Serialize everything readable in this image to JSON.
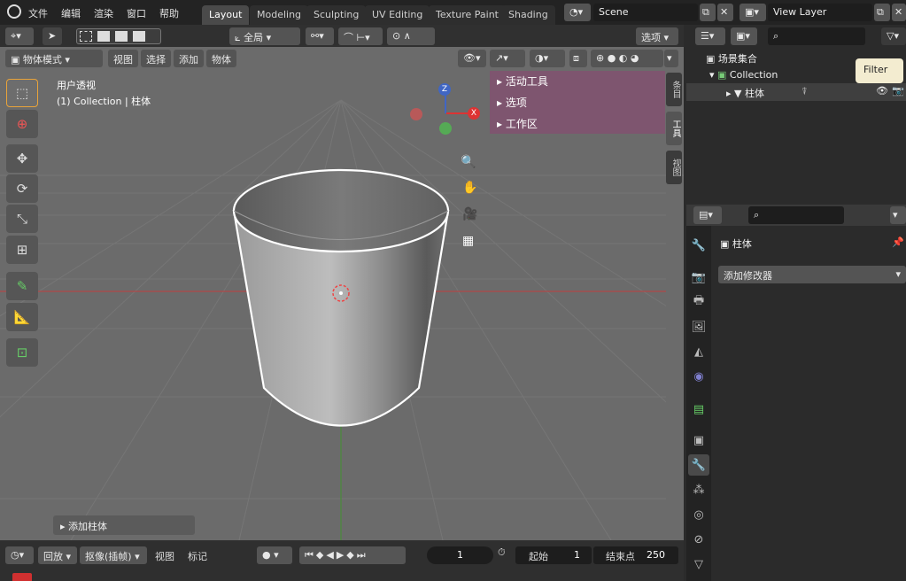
{
  "menu": {
    "file": "文件",
    "edit": "编辑",
    "render": "渲染",
    "window": "窗口",
    "help": "帮助"
  },
  "workspaces": [
    "Layout",
    "Modeling",
    "Sculpting",
    "UV Editing",
    "Texture Paint",
    "Shading"
  ],
  "scene": {
    "name": "Scene",
    "view_layer": "View Layer"
  },
  "header": {
    "orientation": "全局",
    "options": "选项"
  },
  "viewport_header": {
    "mode": "物体模式",
    "view": "视图",
    "select": "选择",
    "add": "添加",
    "object": "物体"
  },
  "overlay": {
    "view_name": "用户透视",
    "collection_info": "(1) Collection | 柱体"
  },
  "gizmo": {
    "z": "Z",
    "x": "X"
  },
  "npanel": {
    "active_tool": "活动工具",
    "options": "选项",
    "workspace": "工作区"
  },
  "side_tabs": [
    "条目",
    "工具",
    "视图"
  ],
  "last_operator": "添加柱体",
  "outliner": {
    "scene_collection": "场景集合",
    "collection": "Collection",
    "object": "柱体",
    "tooltip": "Filter"
  },
  "properties": {
    "object_name": "柱体",
    "add_modifier": "添加修改器"
  },
  "timeline": {
    "playback": "回放",
    "keying": "抠像(插帧)",
    "view": "视图",
    "marker": "标记",
    "current_frame": "1",
    "start_label": "起始",
    "start": "1",
    "end_label": "结束点",
    "end": "250"
  },
  "colors": {
    "npanel": "#805470",
    "accent": "#4772b3",
    "axis_x": "#c33",
    "axis_y": "#3a3"
  }
}
